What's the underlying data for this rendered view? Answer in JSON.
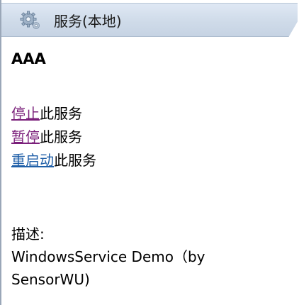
{
  "header": {
    "title": "服务(本地)",
    "icon": "gear-icon"
  },
  "service": {
    "name": "AAA"
  },
  "actions": [
    {
      "link": "停止",
      "suffix": "此服务",
      "visited": true
    },
    {
      "link": "暂停",
      "suffix": "此服务",
      "visited": true
    },
    {
      "link": "重启动",
      "suffix": "此服务",
      "visited": false
    }
  ],
  "description": {
    "label": "描述:",
    "text": "WindowsService Demo（by SensorWU)"
  },
  "colors": {
    "visited_link": "#7a1f7a",
    "link": "#1f5fa8",
    "header_bg": "#cfdbe9"
  }
}
